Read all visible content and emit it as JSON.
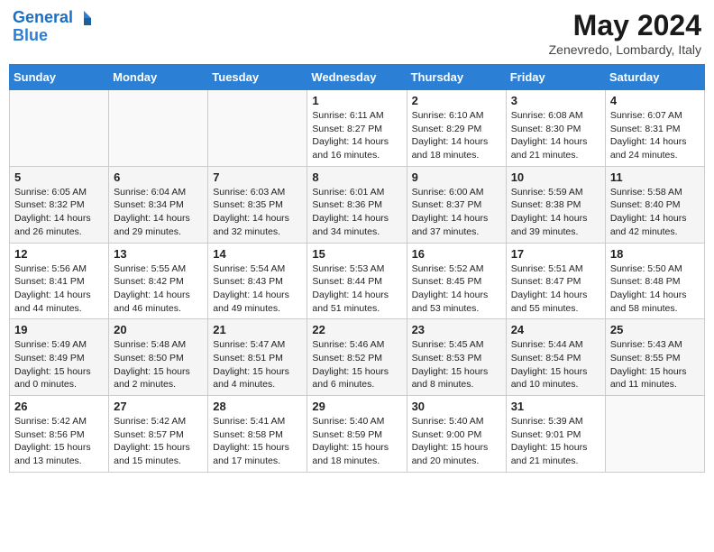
{
  "header": {
    "logo_line1": "General",
    "logo_line2": "Blue",
    "month_title": "May 2024",
    "location": "Zenevredo, Lombardy, Italy"
  },
  "weekdays": [
    "Sunday",
    "Monday",
    "Tuesday",
    "Wednesday",
    "Thursday",
    "Friday",
    "Saturday"
  ],
  "weeks": [
    [
      {
        "day": "",
        "info": ""
      },
      {
        "day": "",
        "info": ""
      },
      {
        "day": "",
        "info": ""
      },
      {
        "day": "1",
        "info": "Sunrise: 6:11 AM\nSunset: 8:27 PM\nDaylight: 14 hours\nand 16 minutes."
      },
      {
        "day": "2",
        "info": "Sunrise: 6:10 AM\nSunset: 8:29 PM\nDaylight: 14 hours\nand 18 minutes."
      },
      {
        "day": "3",
        "info": "Sunrise: 6:08 AM\nSunset: 8:30 PM\nDaylight: 14 hours\nand 21 minutes."
      },
      {
        "day": "4",
        "info": "Sunrise: 6:07 AM\nSunset: 8:31 PM\nDaylight: 14 hours\nand 24 minutes."
      }
    ],
    [
      {
        "day": "5",
        "info": "Sunrise: 6:05 AM\nSunset: 8:32 PM\nDaylight: 14 hours\nand 26 minutes."
      },
      {
        "day": "6",
        "info": "Sunrise: 6:04 AM\nSunset: 8:34 PM\nDaylight: 14 hours\nand 29 minutes."
      },
      {
        "day": "7",
        "info": "Sunrise: 6:03 AM\nSunset: 8:35 PM\nDaylight: 14 hours\nand 32 minutes."
      },
      {
        "day": "8",
        "info": "Sunrise: 6:01 AM\nSunset: 8:36 PM\nDaylight: 14 hours\nand 34 minutes."
      },
      {
        "day": "9",
        "info": "Sunrise: 6:00 AM\nSunset: 8:37 PM\nDaylight: 14 hours\nand 37 minutes."
      },
      {
        "day": "10",
        "info": "Sunrise: 5:59 AM\nSunset: 8:38 PM\nDaylight: 14 hours\nand 39 minutes."
      },
      {
        "day": "11",
        "info": "Sunrise: 5:58 AM\nSunset: 8:40 PM\nDaylight: 14 hours\nand 42 minutes."
      }
    ],
    [
      {
        "day": "12",
        "info": "Sunrise: 5:56 AM\nSunset: 8:41 PM\nDaylight: 14 hours\nand 44 minutes."
      },
      {
        "day": "13",
        "info": "Sunrise: 5:55 AM\nSunset: 8:42 PM\nDaylight: 14 hours\nand 46 minutes."
      },
      {
        "day": "14",
        "info": "Sunrise: 5:54 AM\nSunset: 8:43 PM\nDaylight: 14 hours\nand 49 minutes."
      },
      {
        "day": "15",
        "info": "Sunrise: 5:53 AM\nSunset: 8:44 PM\nDaylight: 14 hours\nand 51 minutes."
      },
      {
        "day": "16",
        "info": "Sunrise: 5:52 AM\nSunset: 8:45 PM\nDaylight: 14 hours\nand 53 minutes."
      },
      {
        "day": "17",
        "info": "Sunrise: 5:51 AM\nSunset: 8:47 PM\nDaylight: 14 hours\nand 55 minutes."
      },
      {
        "day": "18",
        "info": "Sunrise: 5:50 AM\nSunset: 8:48 PM\nDaylight: 14 hours\nand 58 minutes."
      }
    ],
    [
      {
        "day": "19",
        "info": "Sunrise: 5:49 AM\nSunset: 8:49 PM\nDaylight: 15 hours\nand 0 minutes."
      },
      {
        "day": "20",
        "info": "Sunrise: 5:48 AM\nSunset: 8:50 PM\nDaylight: 15 hours\nand 2 minutes."
      },
      {
        "day": "21",
        "info": "Sunrise: 5:47 AM\nSunset: 8:51 PM\nDaylight: 15 hours\nand 4 minutes."
      },
      {
        "day": "22",
        "info": "Sunrise: 5:46 AM\nSunset: 8:52 PM\nDaylight: 15 hours\nand 6 minutes."
      },
      {
        "day": "23",
        "info": "Sunrise: 5:45 AM\nSunset: 8:53 PM\nDaylight: 15 hours\nand 8 minutes."
      },
      {
        "day": "24",
        "info": "Sunrise: 5:44 AM\nSunset: 8:54 PM\nDaylight: 15 hours\nand 10 minutes."
      },
      {
        "day": "25",
        "info": "Sunrise: 5:43 AM\nSunset: 8:55 PM\nDaylight: 15 hours\nand 11 minutes."
      }
    ],
    [
      {
        "day": "26",
        "info": "Sunrise: 5:42 AM\nSunset: 8:56 PM\nDaylight: 15 hours\nand 13 minutes."
      },
      {
        "day": "27",
        "info": "Sunrise: 5:42 AM\nSunset: 8:57 PM\nDaylight: 15 hours\nand 15 minutes."
      },
      {
        "day": "28",
        "info": "Sunrise: 5:41 AM\nSunset: 8:58 PM\nDaylight: 15 hours\nand 17 minutes."
      },
      {
        "day": "29",
        "info": "Sunrise: 5:40 AM\nSunset: 8:59 PM\nDaylight: 15 hours\nand 18 minutes."
      },
      {
        "day": "30",
        "info": "Sunrise: 5:40 AM\nSunset: 9:00 PM\nDaylight: 15 hours\nand 20 minutes."
      },
      {
        "day": "31",
        "info": "Sunrise: 5:39 AM\nSunset: 9:01 PM\nDaylight: 15 hours\nand 21 minutes."
      },
      {
        "day": "",
        "info": ""
      }
    ]
  ]
}
